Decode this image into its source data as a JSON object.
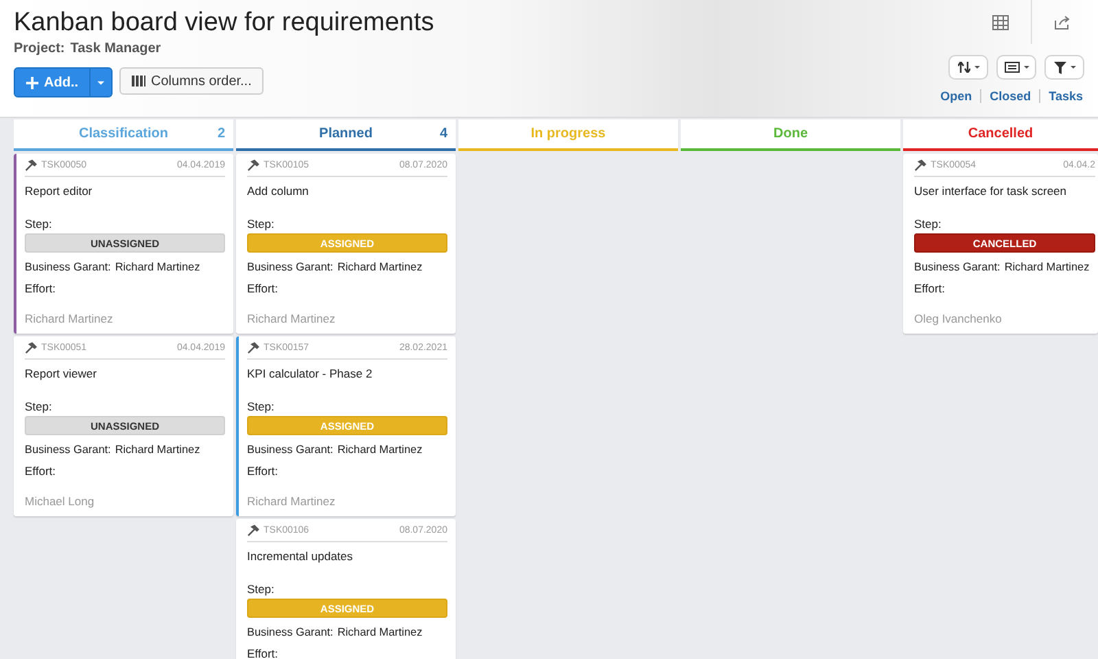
{
  "header": {
    "title": "Kanban board view for requirements",
    "project_label": "Project:",
    "project_name": "Task Manager",
    "add_button": "Add..",
    "columns_order_button": "Columns order...",
    "links": [
      "Open",
      "Closed",
      "Tasks"
    ]
  },
  "columns": [
    {
      "name": "Classification",
      "count": "2",
      "color": "#5aa6dc",
      "cards": [
        {
          "id": "TSK00050",
          "date": "04.04.2019",
          "title": "Report editor",
          "step_label": "Step:",
          "step": "UNASSIGNED",
          "kind": "unassigned",
          "garant_label": "Business Garant:",
          "garant": "Richard Martinez",
          "effort_label": "Effort:",
          "author": "Richard Martinez",
          "color": "#8e5ea2"
        },
        {
          "id": "TSK00051",
          "date": "04.04.2019",
          "title": "Report viewer",
          "step_label": "Step:",
          "step": "UNASSIGNED",
          "kind": "unassigned",
          "garant_label": "Business Garant:",
          "garant": "Richard Martinez",
          "effort_label": "Effort:",
          "author": "Michael Long",
          "color": "#ffffff"
        }
      ]
    },
    {
      "name": "Planned",
      "count": "4",
      "color": "#2f6fa8",
      "cards": [
        {
          "id": "TSK00105",
          "date": "08.07.2020",
          "title": "Add column",
          "step_label": "Step:",
          "step": "ASSIGNED",
          "kind": "assigned",
          "garant_label": "Business Garant:",
          "garant": "Richard Martinez",
          "effort_label": "Effort:",
          "author": "Richard Martinez",
          "color": "#ffffff"
        },
        {
          "id": "TSK00157",
          "date": "28.02.2021",
          "title": "KPI calculator - Phase 2",
          "step_label": "Step:",
          "step": "ASSIGNED",
          "kind": "assigned",
          "garant_label": "Business Garant:",
          "garant": "Richard Martinez",
          "effort_label": "Effort:",
          "author": "Richard Martinez",
          "color": "#3d9be0"
        },
        {
          "id": "TSK00106",
          "date": "08.07.2020",
          "title": "Incremental updates",
          "step_label": "Step:",
          "step": "ASSIGNED",
          "kind": "assigned",
          "garant_label": "Business Garant:",
          "garant": "Richard Martinez",
          "effort_label": "Effort:",
          "color": "#ffffff"
        }
      ]
    },
    {
      "name": "In progress",
      "color": "#e8b820"
    },
    {
      "name": "Done",
      "color": "#5cb83a"
    },
    {
      "name": "Cancelled",
      "color": "#e02424",
      "cards": [
        {
          "id": "TSK00054",
          "date": "04.04.2",
          "title": "User interface for task screen",
          "step_label": "Step:",
          "step": "CANCELLED",
          "kind": "cancelled",
          "garant_label": "Business Garant:",
          "garant": "Richard Martinez",
          "effort_label": "Effort:",
          "author": "Oleg Ivanchenko",
          "color": "#ffffff"
        }
      ]
    }
  ]
}
